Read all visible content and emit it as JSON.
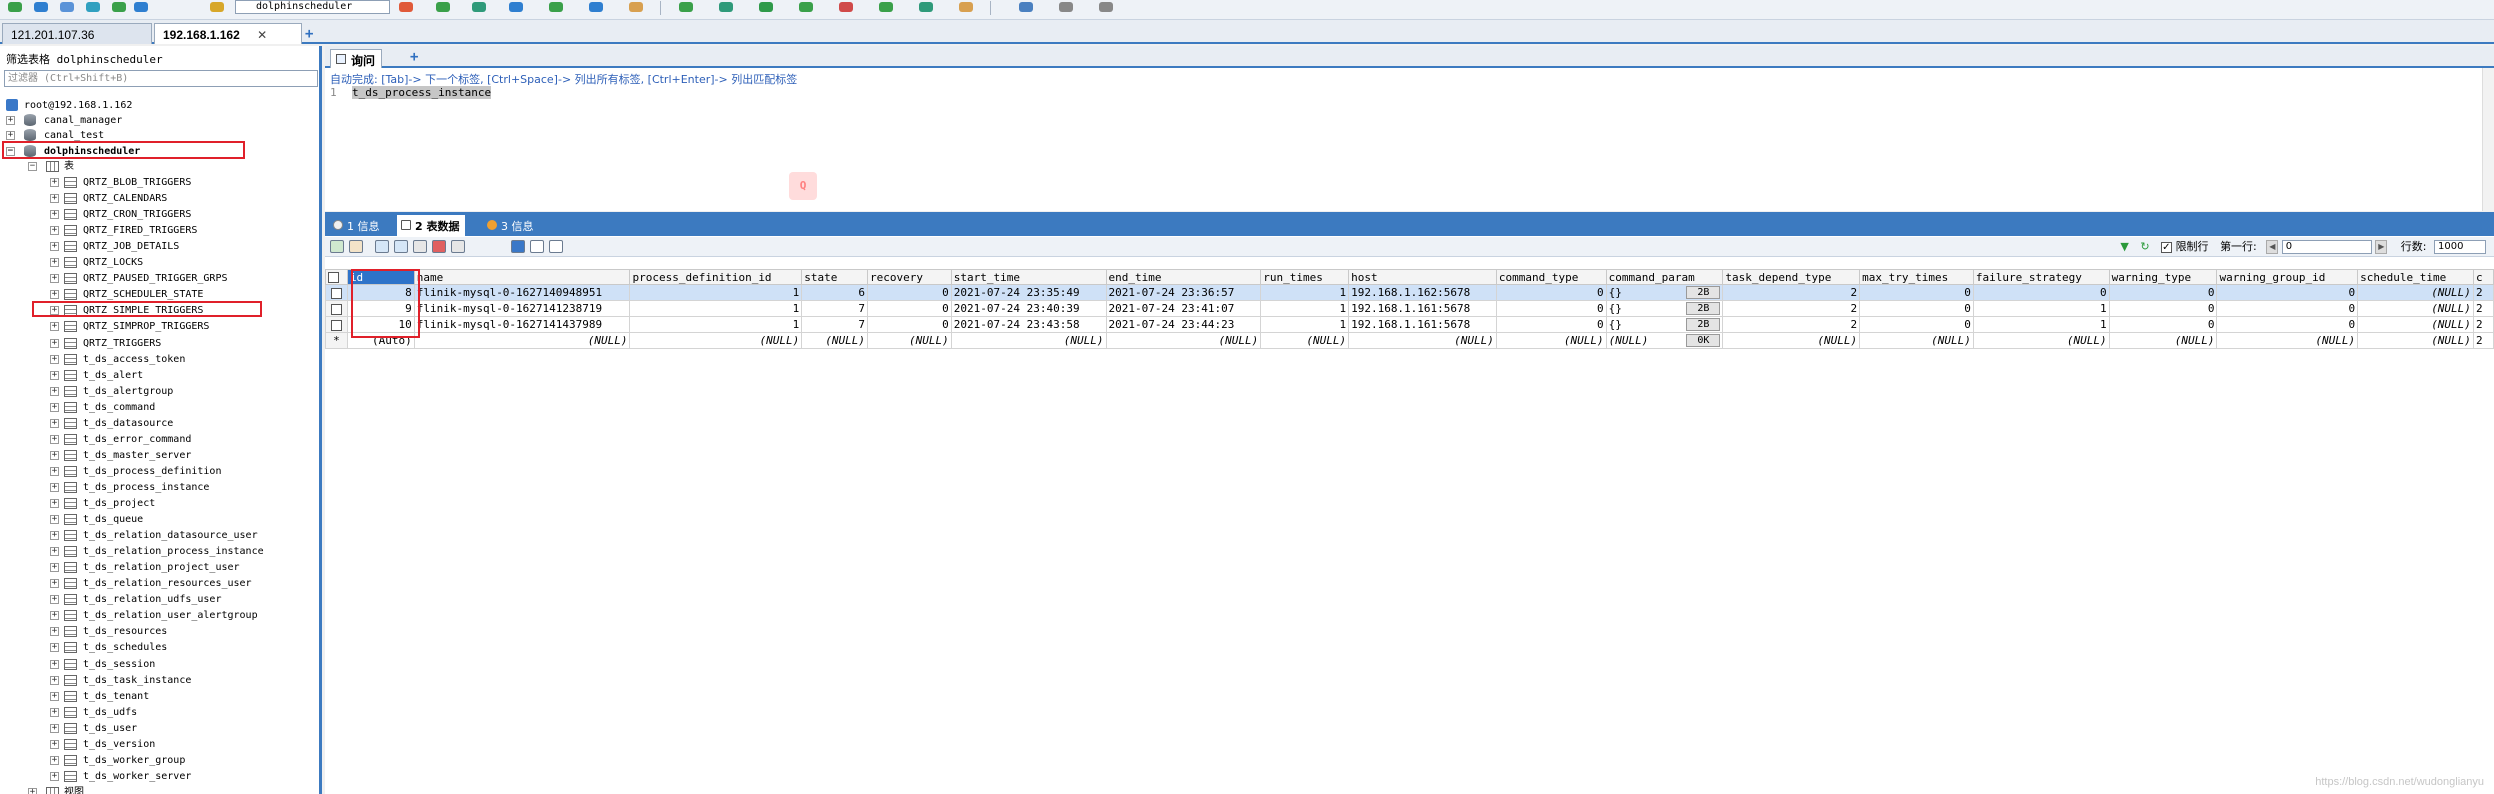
{
  "toolbar": {
    "database_selector": "dolphinscheduler"
  },
  "connection_tabs": [
    {
      "label": "121.201.107.36",
      "active": false
    },
    {
      "label": "192.168.1.162",
      "active": true
    }
  ],
  "left_panel": {
    "filter_title": "筛选表格 dolphinscheduler",
    "filter_placeholder": "过滤器 (Ctrl+Shift+B)",
    "root": "root@192.168.1.162",
    "databases": [
      "canal_manager",
      "canal_test",
      "dolphinscheduler"
    ],
    "tables_folder": "表",
    "tables": [
      "QRTZ_BLOB_TRIGGERS",
      "QRTZ_CALENDARS",
      "QRTZ_CRON_TRIGGERS",
      "QRTZ_FIRED_TRIGGERS",
      "QRTZ_JOB_DETAILS",
      "QRTZ_LOCKS",
      "QRTZ_PAUSED_TRIGGER_GRPS",
      "QRTZ_SCHEDULER_STATE",
      "QRTZ_SIMPLE_TRIGGERS",
      "QRTZ_SIMPROP_TRIGGERS",
      "QRTZ_TRIGGERS",
      "t_ds_access_token",
      "t_ds_alert",
      "t_ds_alertgroup",
      "t_ds_command",
      "t_ds_datasource",
      "t_ds_error_command",
      "t_ds_master_server",
      "t_ds_process_definition",
      "t_ds_process_instance",
      "t_ds_project",
      "t_ds_queue",
      "t_ds_relation_datasource_user",
      "t_ds_relation_process_instance",
      "t_ds_relation_project_user",
      "t_ds_relation_resources_user",
      "t_ds_relation_udfs_user",
      "t_ds_relation_user_alertgroup",
      "t_ds_resources",
      "t_ds_schedules",
      "t_ds_session",
      "t_ds_task_instance",
      "t_ds_tenant",
      "t_ds_udfs",
      "t_ds_user",
      "t_ds_version",
      "t_ds_worker_group",
      "t_ds_worker_server"
    ],
    "views_folder": "视图"
  },
  "editor": {
    "tab_label": "询问",
    "hint": "自动完成: [Tab]-> 下一个标签, [Ctrl+Space]-> 列出所有标签, [Ctrl+Enter]-> 列出匹配标签",
    "line_number": "1",
    "query_text": "t_ds_process_instance"
  },
  "result_tabs": [
    {
      "label": "1 信息",
      "active": false
    },
    {
      "label": "2 表数据",
      "active": true
    },
    {
      "label": "3 信息",
      "active": false
    }
  ],
  "result_toolbar": {
    "limit_rows_label": "限制行",
    "first_row_label": "第一行:",
    "first_row_value": "0",
    "row_count_label": "行数:",
    "row_count_value": "1000"
  },
  "grid": {
    "columns": [
      "id",
      "name",
      "process_definition_id",
      "state",
      "recovery",
      "start_time",
      "end_time",
      "run_times",
      "host",
      "command_type",
      "command_param",
      "task_depend_type",
      "max_try_times",
      "failure_strategy",
      "warning_type",
      "warning_group_id",
      "schedule_time",
      "c"
    ],
    "rows": [
      [
        "8",
        "flinik-mysql-0-1627140948951",
        "1",
        "6",
        "0",
        "2021-07-24 23:35:49",
        "2021-07-24 23:36:57",
        "1",
        "192.168.1.162:5678",
        "0",
        "{}",
        "2B",
        "2",
        "0",
        "0",
        "0",
        "0",
        "(NULL)",
        "2"
      ],
      [
        "9",
        "flinik-mysql-0-1627141238719",
        "1",
        "7",
        "0",
        "2021-07-24 23:40:39",
        "2021-07-24 23:41:07",
        "1",
        "192.168.1.161:5678",
        "0",
        "{}",
        "2B",
        "2",
        "0",
        "1",
        "0",
        "0",
        "(NULL)",
        "2"
      ],
      [
        "10",
        "flinik-mysql-0-1627141437989",
        "1",
        "7",
        "0",
        "2021-07-24 23:43:58",
        "2021-07-24 23:44:23",
        "1",
        "192.168.1.161:5678",
        "0",
        "{}",
        "2B",
        "2",
        "0",
        "1",
        "0",
        "0",
        "(NULL)",
        "2"
      ]
    ],
    "new_row": [
      "(Auto)",
      "(NULL)",
      "(NULL)",
      "(NULL)",
      "(NULL)",
      "(NULL)",
      "(NULL)",
      "(NULL)",
      "(NULL)",
      "(NULL)",
      "(NULL)",
      "0K",
      "(NULL)",
      "(NULL)",
      "(NULL)",
      "(NULL)",
      "(NULL)",
      "(NULL)",
      "2"
    ],
    "new_row_marker": "*"
  },
  "footer": "https://blog.csdn.net/wudonglianyu",
  "colors": {
    "accent": "#3c7ac0",
    "highlight": "#e0202a",
    "selected_row": "#cfe1f7"
  }
}
